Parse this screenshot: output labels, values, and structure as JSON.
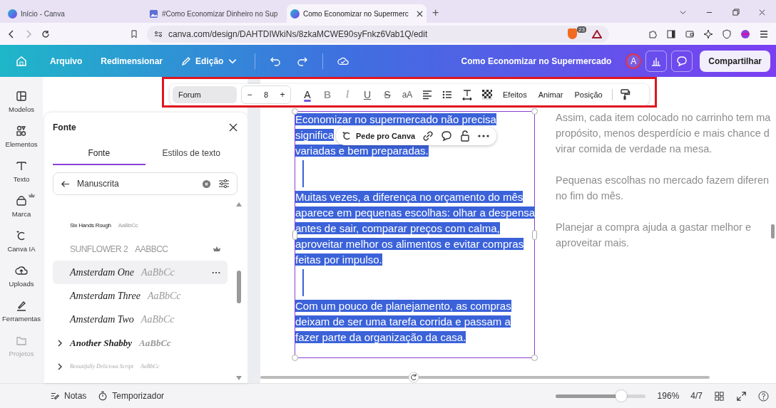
{
  "browser": {
    "tabs": [
      {
        "title": "Início - Canva",
        "selected": false
      },
      {
        "title": "#Como Economizar Dinheiro no Sup",
        "selected": false
      },
      {
        "title": "Como Economizar no Supermerc",
        "selected": true
      }
    ],
    "new_tab": "+",
    "address": "canva.com/design/DAHTDIWkiNs/8zkaMCWE90syFnkz6Vab1Q/edit",
    "shield_badge": "23"
  },
  "header": {
    "menu": [
      {
        "label": "Arquivo",
        "kind": "plain"
      },
      {
        "label": "Redimensionar",
        "kind": "plain"
      },
      {
        "label": "Edição",
        "kind": "dropdown"
      }
    ],
    "title": "Como Economizar no Supermercado",
    "avatar": "A",
    "share": "Compartilhar"
  },
  "toolbar": {
    "font": "Forum",
    "minus": "−",
    "size": "8",
    "plus": "+",
    "format": [
      {
        "label": "A",
        "kind": "color"
      },
      {
        "label": "B",
        "kind": "bold"
      },
      {
        "label": "I",
        "kind": "italic"
      },
      {
        "label": "U",
        "kind": "underline"
      },
      {
        "label": "S",
        "kind": "strike"
      },
      {
        "label": "aA",
        "kind": "case"
      }
    ],
    "actions": [
      "Efeitos",
      "Animar",
      "Posição"
    ]
  },
  "sidebar": [
    {
      "label": "Modelos",
      "disabled": false,
      "premium": false
    },
    {
      "label": "Elementos",
      "disabled": false,
      "premium": false
    },
    {
      "label": "Texto",
      "disabled": false,
      "premium": false
    },
    {
      "label": "Marca",
      "disabled": false,
      "premium": true
    },
    {
      "label": "Canva IA",
      "disabled": false,
      "premium": false
    },
    {
      "label": "Uploads",
      "disabled": false,
      "premium": false
    },
    {
      "label": "Ferramentas",
      "disabled": false,
      "premium": false
    },
    {
      "label": "Projetos",
      "disabled": true,
      "premium": false
    }
  ],
  "font_panel": {
    "title": "Fonte",
    "tabs": [
      {
        "label": "Fonte",
        "selected": true
      },
      {
        "label": "Estilos de texto",
        "selected": false
      }
    ],
    "search": {
      "value": "Manuscrita"
    },
    "fonts": [
      {
        "name": "Six Hands Rough",
        "sample": "AaBbCc",
        "kind": "condensed",
        "premium": false,
        "selected": false,
        "expandable": false
      },
      {
        "name": "SUNFLOWER 2",
        "sample": "AABBCC",
        "kind": "thin",
        "premium": true,
        "selected": false,
        "expandable": false
      },
      {
        "name": "Amsterdam One",
        "sample": "AaBbCc",
        "kind": "script",
        "premium": false,
        "selected": true,
        "expandable": false
      },
      {
        "name": "Amsterdam Three",
        "sample": "AaBbCc",
        "kind": "script",
        "premium": false,
        "selected": false,
        "expandable": false
      },
      {
        "name": "Amsterdam Two",
        "sample": "AaBbCc",
        "kind": "script",
        "premium": false,
        "selected": false,
        "expandable": false
      },
      {
        "name": "Another Shabby",
        "sample": "AaBbCc",
        "kind": "bold-script",
        "premium": false,
        "selected": false,
        "expandable": true
      },
      {
        "name": "Beautifully Delicious Script",
        "sample": "AaBbCc",
        "kind": "faint",
        "premium": false,
        "selected": false,
        "expandable": true
      }
    ]
  },
  "text_box": {
    "paragraphs": [
      [
        "Economizar no supermercado não precisa",
        "significa",
        "variadas e bem preparadas."
      ],
      [
        "Muitas vezes, a diferença no orçamento do mês",
        "aparece em pequenas escolhas: olhar a despensa",
        "antes de sair, comparar preços com calma,",
        "aproveitar melhor os alimentos e evitar compras",
        "feitas por impulso."
      ],
      [
        "Com um pouco de planejamento, as compras",
        "deixam de ser uma tarefa corrida e passam a",
        "fazer parte da organização da casa."
      ]
    ]
  },
  "popup": {
    "label": "Pede pro Canva"
  },
  "side_text": [
    [
      "Assim, cada item colocado no carrinho tem ma",
      "propósito, menos desperdício e mais chance d",
      "virar comida de verdade na mesa."
    ],
    [
      "Pequenas escolhas no mercado fazem diferen",
      "no fim do mês."
    ],
    [
      "Planejar a compra ajuda a gastar melhor e",
      "aproveitar mais."
    ]
  ],
  "footer": {
    "notes": "Notas",
    "timer": "Temporizador",
    "zoom": {
      "level": 0.73
    },
    "zoom_label": "196%",
    "page": "4/7"
  }
}
